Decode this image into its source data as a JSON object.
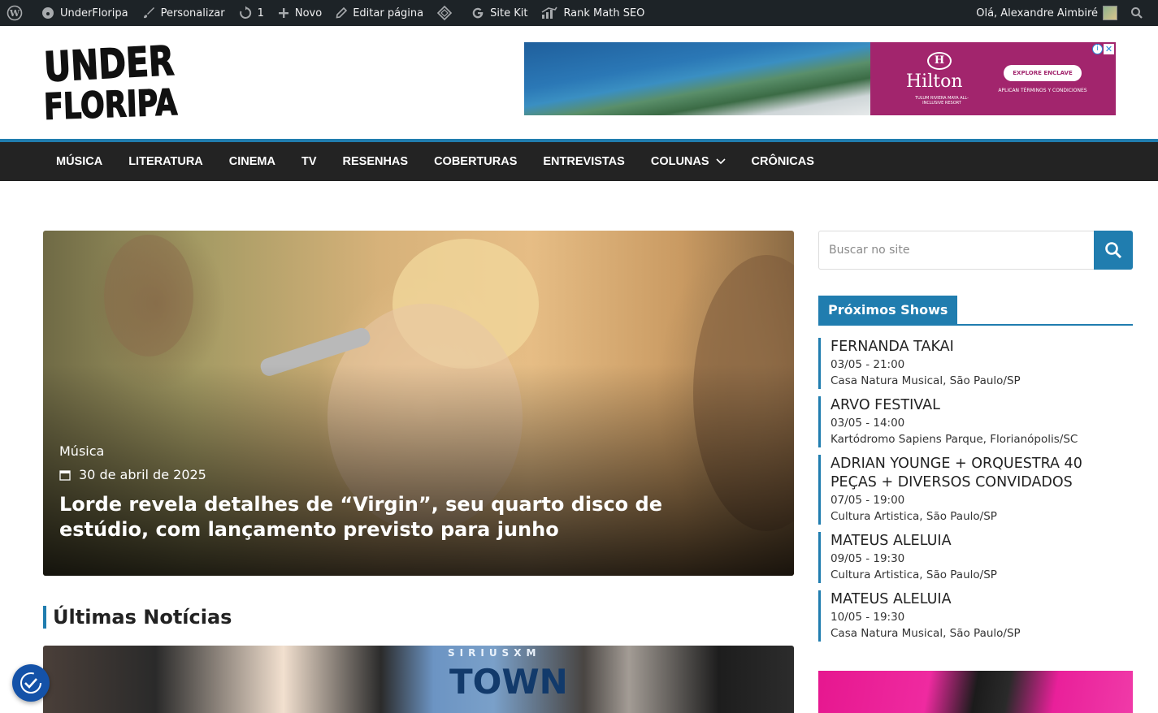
{
  "adminbar": {
    "site_name": "UnderFloripa",
    "customize": "Personalizar",
    "updates_count": "1",
    "new": "Novo",
    "edit_page": "Editar página",
    "site_kit": "Site Kit",
    "rank_math": "Rank Math SEO",
    "greeting": "Olá, Alexandre Aimbiré"
  },
  "header": {
    "logo_line1": "UNDER",
    "logo_line2": "FLORIPA"
  },
  "ad": {
    "brand": "Hilton",
    "brand_sub": "TULUM RIVIERA MAYA ALL-INCLUSIVE RESORT",
    "cta": "EXPLORE ENCLAVE",
    "terms": "APLICAN TÉRMINOS Y CONDICIONES"
  },
  "nav": {
    "items": [
      "Música",
      "Literatura",
      "Cinema",
      "TV",
      "Resenhas",
      "Coberturas",
      "Entrevistas",
      "Colunas",
      "Crônicas"
    ]
  },
  "hero": {
    "category": "Música",
    "date": "30 de abril de 2025",
    "title": "Lorde revela detalhes de “Virgin”, seu quarto disco de estúdio, com lançamento previsto para junho"
  },
  "latest": {
    "title": "Últimas Notícias",
    "image_text_top": "SIRIUSXM",
    "image_text_big": "TOWN"
  },
  "search": {
    "placeholder": "Buscar no site"
  },
  "shows_widget": {
    "title": "Próximos Shows",
    "items": [
      {
        "name": "FERNANDA TAKAI",
        "date": "03/05 - 21:00",
        "place": "Casa Natura Musical, São Paulo/SP"
      },
      {
        "name": "ARVO FESTIVAL",
        "date": "03/05 - 14:00",
        "place": "Kartódromo Sapiens Parque, Florianópolis/SC"
      },
      {
        "name": "ADRIAN YOUNGE + ORQUESTRA 40 PEÇAS + DIVERSOS CONVIDADOS",
        "date": "07/05 - 19:00",
        "place": "Cultura Artistica, São Paulo/SP"
      },
      {
        "name": "MATEUS ALELUIA",
        "date": "09/05 - 19:30",
        "place": "Cultura Artistica, São Paulo/SP"
      },
      {
        "name": "MATEUS ALELUIA",
        "date": "10/05 - 19:30",
        "place": "Casa Natura Musical, São Paulo/SP"
      }
    ]
  },
  "colors": {
    "accent": "#207daf",
    "admin_bar": "#1d2327",
    "nav_bg": "#232323"
  }
}
